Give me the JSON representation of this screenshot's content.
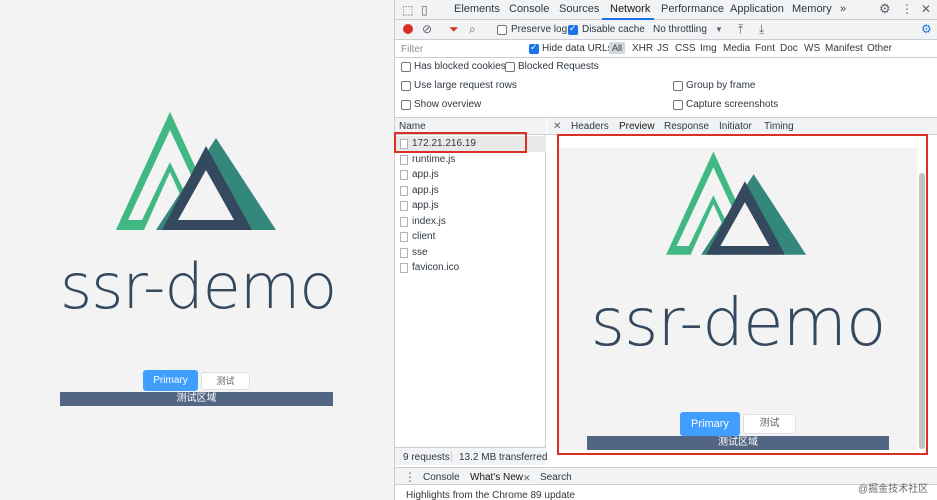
{
  "page": {
    "title": "ssr-demo",
    "primary_button": "Primary",
    "test_button": "测试",
    "test_area": "测试区域",
    "colors": {
      "vue_green": "#41b883",
      "vue_dark": "#35495e",
      "primary": "#409eff",
      "area": "#526683"
    }
  },
  "devtools": {
    "tabs": [
      "Elements",
      "Console",
      "Sources",
      "Network",
      "Performance",
      "Application",
      "Memory"
    ],
    "active_tab": "Network",
    "more_tabs_icon": "»",
    "toolbar": {
      "preserve_log": "Preserve log",
      "disable_cache": "Disable cache",
      "throttling": "No throttling"
    },
    "filter": {
      "placeholder": "Filter",
      "hide_data_urls": "Hide data URLs",
      "types": [
        "All",
        "XHR",
        "JS",
        "CSS",
        "Img",
        "Media",
        "Font",
        "Doc",
        "WS",
        "Manifest",
        "Other"
      ]
    },
    "options": {
      "blocked_cookies": "Has blocked cookies",
      "blocked_requests": "Blocked Requests",
      "large_rows": "Use large request rows",
      "group_by_frame": "Group by frame",
      "show_overview": "Show overview",
      "capture_screenshots": "Capture screenshots"
    },
    "network": {
      "column_name": "Name",
      "requests": [
        "172.21.216.19",
        "runtime.js",
        "app.js",
        "app.js",
        "app.js",
        "index.js",
        "client",
        "sse",
        "favicon.ico"
      ],
      "summary_requests": "9 requests",
      "summary_transferred": "13.2 MB transferred"
    },
    "detail_tabs": [
      "Headers",
      "Preview",
      "Response",
      "Initiator",
      "Timing"
    ],
    "active_detail_tab": "Preview",
    "drawer": {
      "tabs": [
        "Console",
        "What's New",
        "Search"
      ],
      "active": "What's New",
      "body": "Highlights from the Chrome 89 update"
    }
  },
  "watermark": "@掘金技术社区"
}
